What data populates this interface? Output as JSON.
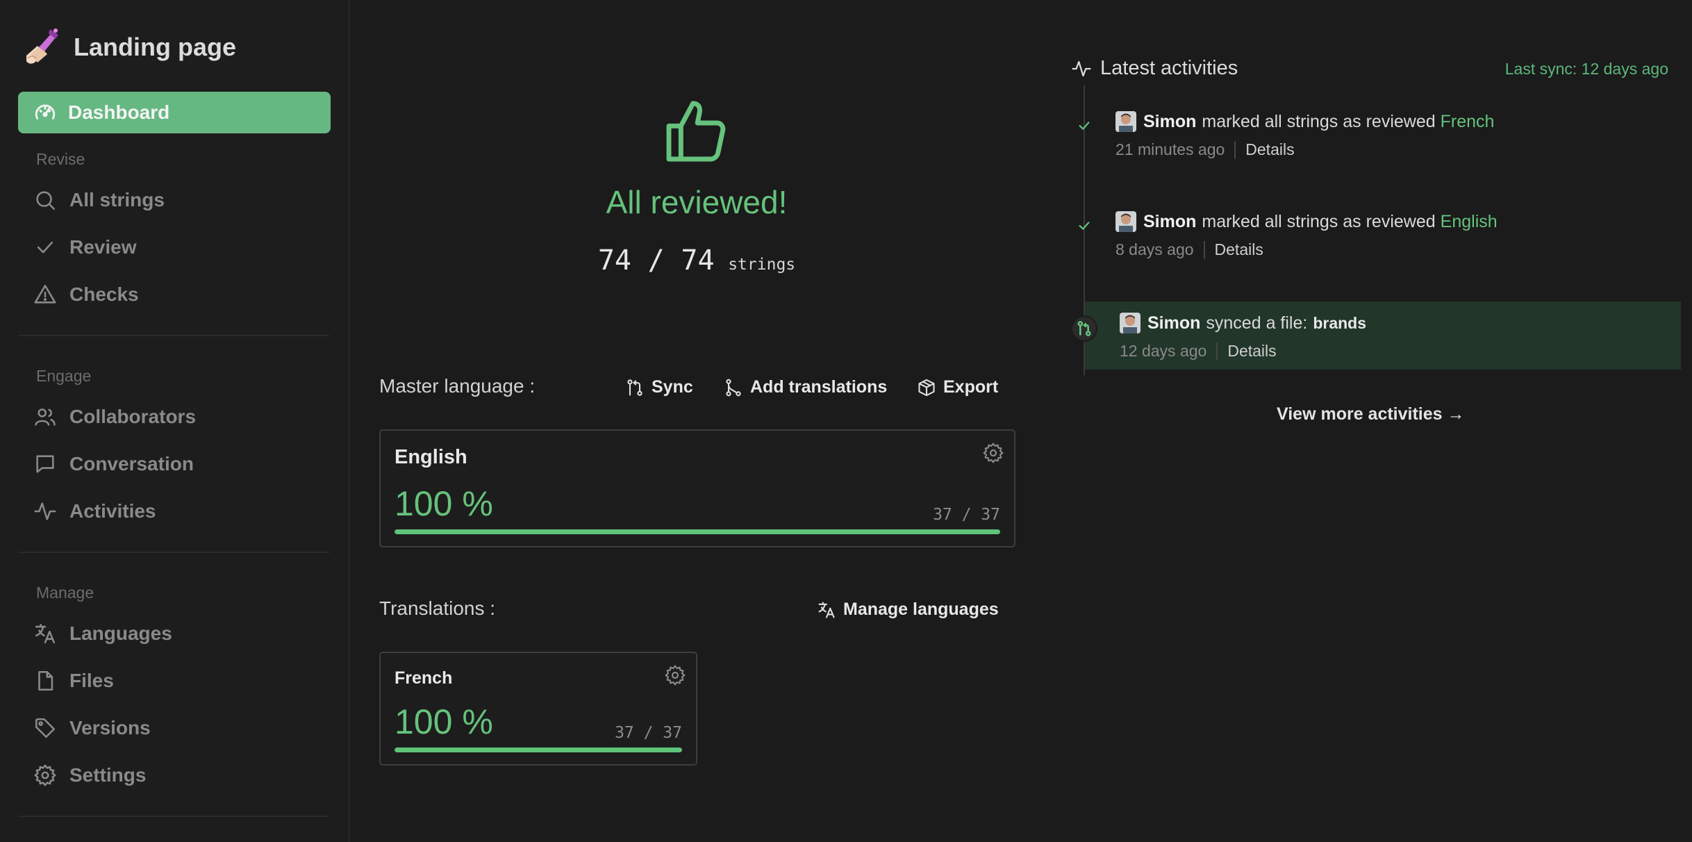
{
  "app": {
    "title": "Landing page"
  },
  "sidebar": {
    "active": {
      "label": "Dashboard",
      "icon": "dashboard-gauge-icon"
    },
    "sections": {
      "revise": {
        "title": "Revise",
        "items": [
          {
            "label": "All strings",
            "icon": "search-icon"
          },
          {
            "label": "Review",
            "icon": "check-icon"
          },
          {
            "label": "Checks",
            "icon": "warning-icon"
          }
        ]
      },
      "engage": {
        "title": "Engage",
        "items": [
          {
            "label": "Collaborators",
            "icon": "users-icon"
          },
          {
            "label": "Conversation",
            "icon": "chat-icon"
          },
          {
            "label": "Activities",
            "icon": "activity-icon"
          }
        ]
      },
      "manage": {
        "title": "Manage",
        "items": [
          {
            "label": "Languages",
            "icon": "translate-icon"
          },
          {
            "label": "Files",
            "icon": "file-icon"
          },
          {
            "label": "Versions",
            "icon": "tag-icon"
          },
          {
            "label": "Settings",
            "icon": "gear-icon"
          }
        ]
      }
    }
  },
  "summary": {
    "headline": "All reviewed!",
    "reviewed": "74",
    "separator": "/",
    "total": "74",
    "unit": "strings",
    "icon": "thumbs-up-icon"
  },
  "master": {
    "label": "Master language :",
    "actions": {
      "sync": "Sync",
      "add_translations": "Add translations",
      "export": "Export"
    },
    "card": {
      "name": "English",
      "percent": "100 %",
      "ratio": "37 / 37",
      "progress": 1.0
    }
  },
  "translations": {
    "label": "Translations :",
    "manage_label": "Manage languages",
    "cards": [
      {
        "name": "French",
        "percent": "100 %",
        "ratio": "37 / 37",
        "progress": 1.0
      }
    ]
  },
  "activities": {
    "title": "Latest activities",
    "last_sync": "Last sync: 12 days ago",
    "details_label": "Details",
    "items": [
      {
        "user": "Simon",
        "action": "marked all strings as reviewed",
        "target": "French",
        "time": "21 minutes ago"
      },
      {
        "user": "Simon",
        "action": "marked all strings as reviewed",
        "target": "English",
        "time": "8 days ago"
      },
      {
        "user": "Simon",
        "action": "synced a file:",
        "target": "brands",
        "time": "12 days ago"
      }
    ],
    "view_more": "View more activities →"
  },
  "colors": {
    "accent": "#66c27c",
    "active_nav": "#66b882",
    "background": "#1b1b1b",
    "highlight_row": "#22362a"
  }
}
